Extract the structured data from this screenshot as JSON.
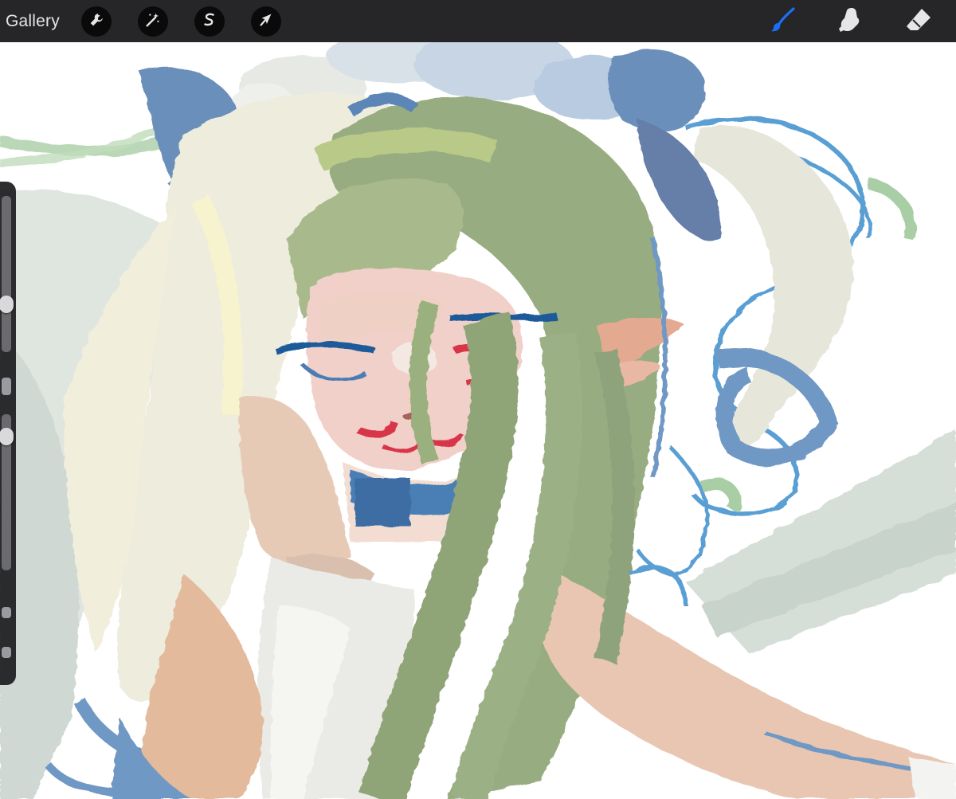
{
  "toolbar": {
    "gallery_label": "Gallery",
    "left_tools": [
      {
        "name": "actions",
        "icon": "wrench-icon"
      },
      {
        "name": "adjustments",
        "icon": "magic-wand-icon"
      },
      {
        "name": "selection",
        "icon": "selection-s-icon"
      },
      {
        "name": "transform",
        "icon": "arrow-cursor-icon"
      }
    ],
    "right_tools": [
      {
        "name": "brush",
        "icon": "brush-icon",
        "active": true
      },
      {
        "name": "smudge",
        "icon": "smudge-finger-icon",
        "active": false
      },
      {
        "name": "eraser",
        "icon": "eraser-icon",
        "active": false
      }
    ],
    "active_color": "#1a6ff5",
    "icon_color": "#e6e6e8"
  },
  "sidebar": {
    "brush_size_slider": {
      "value": 0.28
    },
    "opacity_slider": {
      "value": 0.9
    }
  },
  "canvas": {
    "background": "#ffffff",
    "palette": {
      "hair_cream": "#eeece0",
      "hair_green": "#93a97c",
      "skin": "#e9c6b4",
      "ribbon_blue": "#6488b4",
      "line_blue": "#5a9fd4",
      "wing_grey": "#d4ddd6",
      "blush": "#d9344a"
    }
  }
}
